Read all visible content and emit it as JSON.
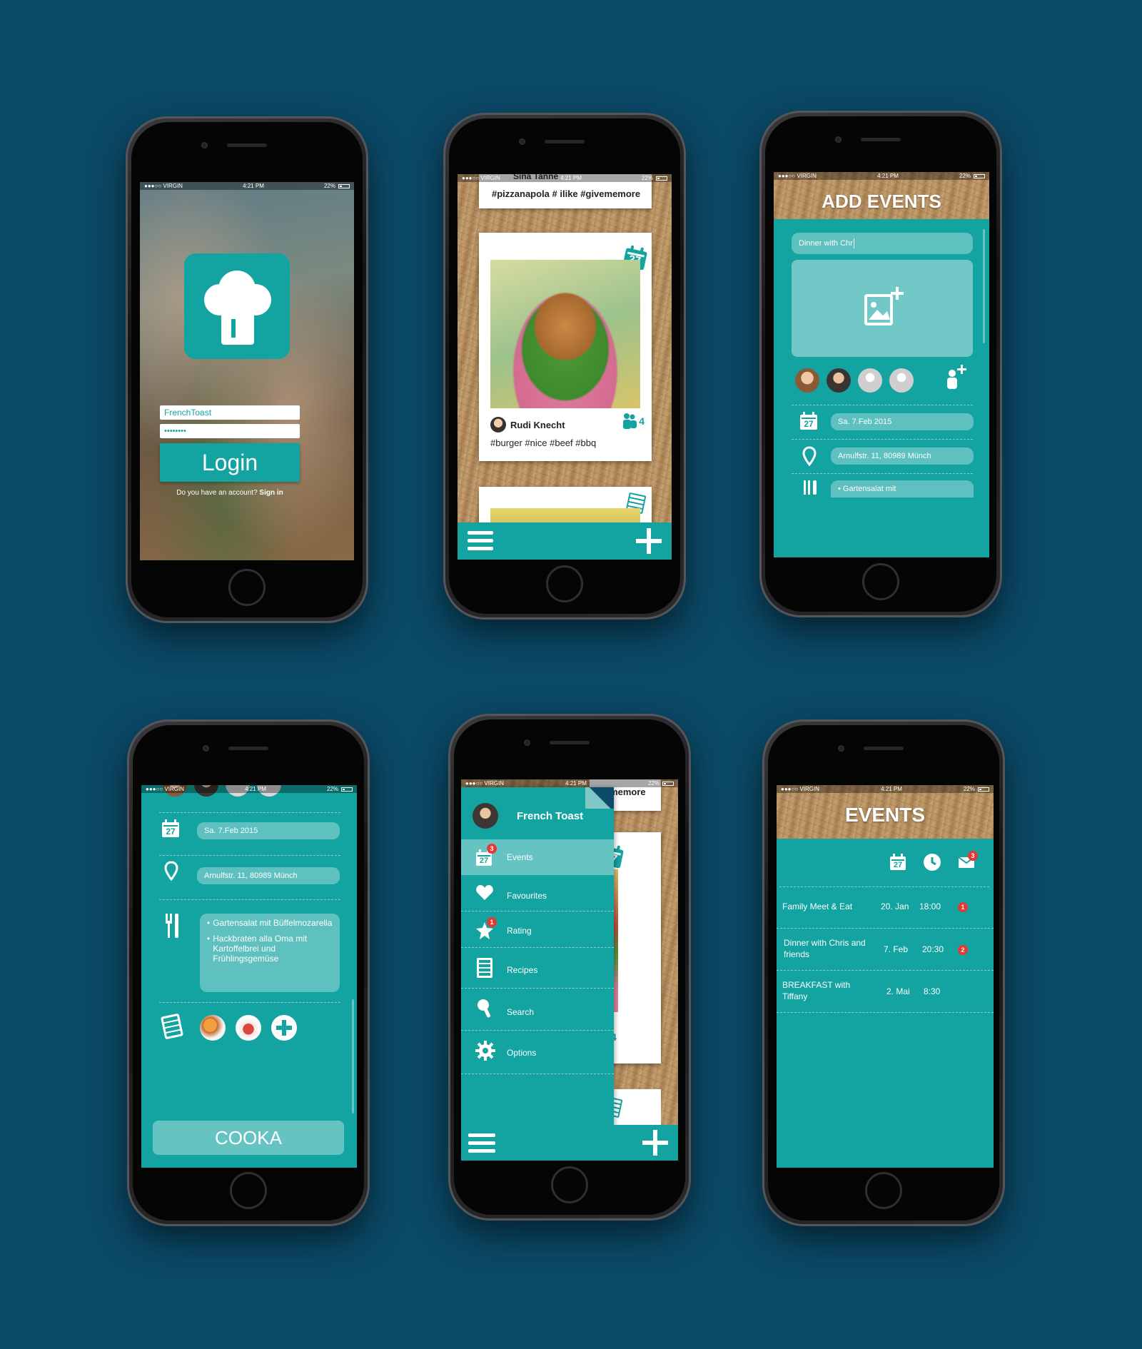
{
  "status": {
    "carrier": "●●●○○ VIRGIN",
    "time": "4:21 PM",
    "battery": "22%"
  },
  "login": {
    "username": "FrenchToast",
    "password": "••••••••",
    "button": "Login",
    "prompt": "Do you have an account?",
    "signin": "Sign in"
  },
  "feed": {
    "top_user": "Sina Tanne",
    "top_tags": "#pizzanapola # ilike #givememore",
    "card_user": "Rudi Knecht",
    "card_tags": "#burger #nice #beef #bbq",
    "card_count": "4",
    "calendar_day": "27"
  },
  "add_event": {
    "title": "ADD EVENTS",
    "name_value": "Dinner with Chr",
    "date": "Sa. 7.Feb 2015",
    "address": "Arnulfstr. 11, 80989 Münch",
    "menu_partial": "• Gartensalat mit",
    "calendar_day": "27"
  },
  "event_detail": {
    "date": "Sa. 7.Feb 2015",
    "address": "Arnulfstr. 11, 80989 Münch",
    "menu_items": [
      "Gartensalat mit Büffelmozarella",
      "Hackbraten alla Oma mit Kartoffelbrei und Frühlingsgemüse"
    ],
    "button": "COOKA",
    "calendar_day": "27"
  },
  "menu": {
    "username": "French Toast",
    "peek_tags": "ivememore",
    "items": [
      {
        "label": "Events",
        "badge": "3"
      },
      {
        "label": "Favourites",
        "badge": ""
      },
      {
        "label": "Rating",
        "badge": "1"
      },
      {
        "label": "Recipes",
        "badge": ""
      },
      {
        "label": "Search",
        "badge": ""
      },
      {
        "label": "Options",
        "badge": ""
      }
    ],
    "peek_count": "4",
    "calendar_day": "27"
  },
  "events": {
    "title": "EVENTS",
    "header_badge": "3",
    "calendar_day": "27",
    "rows": [
      {
        "name": "Family Meet & Eat",
        "date": "20. Jan",
        "time": "18:00",
        "badge": "1"
      },
      {
        "name": "Dinner with Chris and friends",
        "date": "7. Feb",
        "time": "20:30",
        "badge": "2"
      },
      {
        "name": "BREAKFAST with Tiffany",
        "date": "2. Mai",
        "time": "8:30",
        "badge": ""
      }
    ]
  },
  "colors": {
    "background": "#0b4a68",
    "teal": "#13a3a1",
    "badge_red": "#e53935"
  }
}
